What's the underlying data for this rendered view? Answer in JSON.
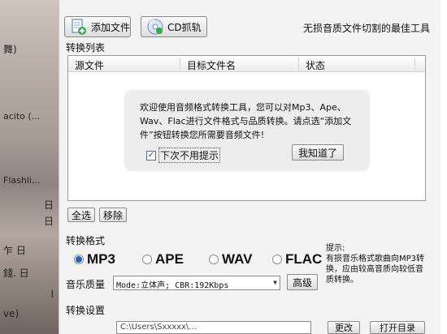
{
  "background_fragments": [
    {
      "text": "舞)"
    },
    {
      "text": "acito (..."
    },
    {
      "text": "Flashli..."
    },
    {
      "text": "日"
    },
    {
      "text": "日"
    },
    {
      "text": "乍   日"
    },
    {
      "text": "錢.  日"
    },
    {
      "text": "l"
    },
    {
      "text": "ve)"
    }
  ],
  "toolbar": {
    "add_file_label": "添加文件",
    "cd_rip_label": "CD抓轨",
    "tagline": "无损音质文件切割的最佳工具"
  },
  "list": {
    "group_label": "转换列表",
    "columns": [
      "源文件",
      "目标文件名",
      "状态"
    ]
  },
  "welcome": {
    "message": "欢迎使用音频格式转换工具，您可以对Mp3、Ape、Wav、Flac进行文件格式与品质转换。请点选“添加文件”按钮转换您所需要音频文件!",
    "dont_show_label": "下次不用提示",
    "dont_show_checked": true,
    "got_it_label": "我知道了"
  },
  "list_actions": {
    "select_all_label": "全选",
    "remove_label": "移除"
  },
  "format": {
    "group_label": "转换格式",
    "options": [
      "MP3",
      "APE",
      "WAV",
      "FLAC"
    ],
    "selected": "MP3",
    "hint_title": "提示:",
    "hint_text": "有损音乐格式歌曲向MP3转换，应由较高音质向较低音质转换。",
    "quality_label": "音乐质量",
    "quality_value": "Mode:立体声; CBR:192Kbps",
    "advanced_label": "高级"
  },
  "settings": {
    "group_label": "转换设置",
    "output_path_partial": "C:\\Users\\Sxxxxx\\...",
    "change_label": "更改",
    "open_folder_label": "打开目录"
  },
  "colors": {
    "accent": "#2b5fb6"
  }
}
